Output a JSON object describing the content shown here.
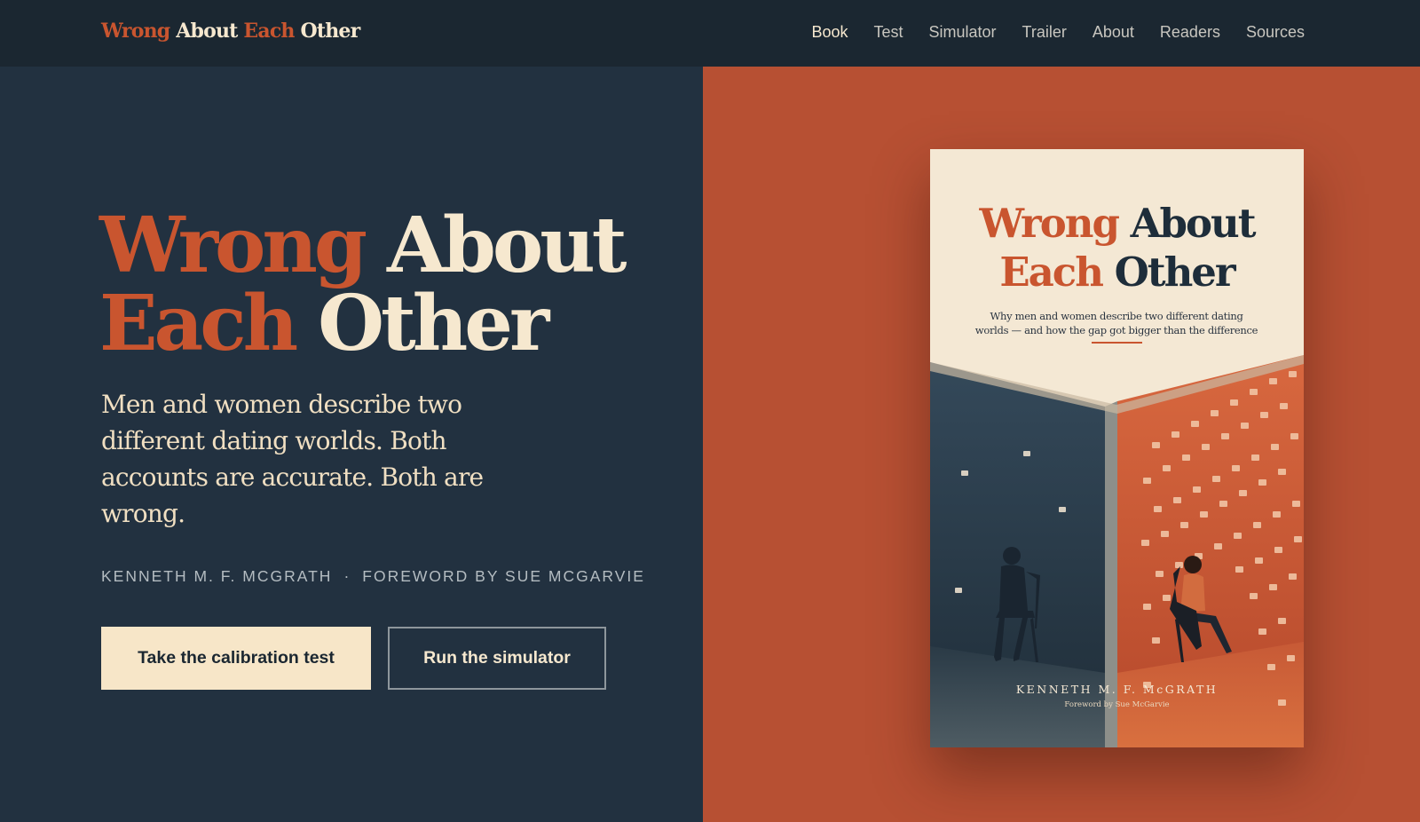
{
  "brand": {
    "part1": "Wrong",
    "part2": "About",
    "part3": "Each",
    "part4": "Other"
  },
  "nav": {
    "items": [
      {
        "label": "Book"
      },
      {
        "label": "Test"
      },
      {
        "label": "Simulator"
      },
      {
        "label": "Trailer"
      },
      {
        "label": "About"
      },
      {
        "label": "Readers"
      },
      {
        "label": "Sources"
      }
    ],
    "active": "Book"
  },
  "hero": {
    "title_line1_accent": "Wrong",
    "title_line1_rest": "About",
    "title_line2_accent": "Each",
    "title_line2_rest": "Other",
    "lede": "Men and women describe two different dating worlds. Both accounts are accurate. Both are wrong.",
    "author": "KENNETH M. F. MCGRATH",
    "separator": "·",
    "foreword": "FOREWORD BY SUE MCGARVIE",
    "primary_cta": "Take the calibration test",
    "secondary_cta": "Run the simulator"
  },
  "cover": {
    "title_word1": "Wrong",
    "title_word2": "About",
    "title_word3": "Each",
    "title_word4": "Other",
    "subtitle": "Why men and women describe two different dating worlds — and how the gap got bigger than the difference",
    "author": "KENNETH M. F. McGRATH",
    "foreword": "Foreword by Sue McGarvie"
  },
  "colors": {
    "accent": "#c9552f",
    "cream": "#f6e8cf",
    "navy": "#223140",
    "rust_panel": "#b75033"
  }
}
